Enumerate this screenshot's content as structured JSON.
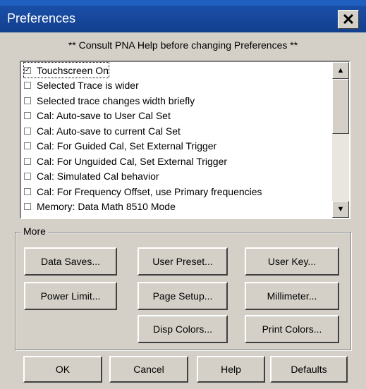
{
  "window": {
    "title": "Preferences",
    "close_icon": "close-icon"
  },
  "notice": "** Consult PNA Help before changing Preferences **",
  "preferences": [
    {
      "label": "Touchscreen On",
      "checked": true
    },
    {
      "label": "Selected Trace is wider",
      "checked": false
    },
    {
      "label": "Selected trace changes width briefly",
      "checked": false
    },
    {
      "label": "Cal: Auto-save to User Cal Set",
      "checked": false
    },
    {
      "label": "Cal: Auto-save to current Cal Set",
      "checked": false
    },
    {
      "label": "Cal: For Guided Cal, Set External Trigger",
      "checked": false
    },
    {
      "label": "Cal: For Unguided Cal, Set External Trigger",
      "checked": false
    },
    {
      "label": "Cal: Simulated Cal behavior",
      "checked": false
    },
    {
      "label": "Cal: For Frequency Offset, use Primary frequencies",
      "checked": false
    },
    {
      "label": "Memory: Data Math 8510 Mode",
      "checked": false
    }
  ],
  "more": {
    "label": "More",
    "buttons": {
      "data_saves": "Data Saves...",
      "user_preset": "User Preset...",
      "user_key": "User Key...",
      "power_limit": "Power Limit...",
      "page_setup": "Page Setup...",
      "millimeter": "Millimeter...",
      "disp_colors": "Disp Colors...",
      "print_colors": "Print Colors..."
    }
  },
  "footer": {
    "ok": "OK",
    "cancel": "Cancel",
    "help": "Help",
    "defaults": "Defaults"
  },
  "colors": {
    "titlebar": "#1a4fa8",
    "dialog_bg": "#d4d0c8"
  }
}
